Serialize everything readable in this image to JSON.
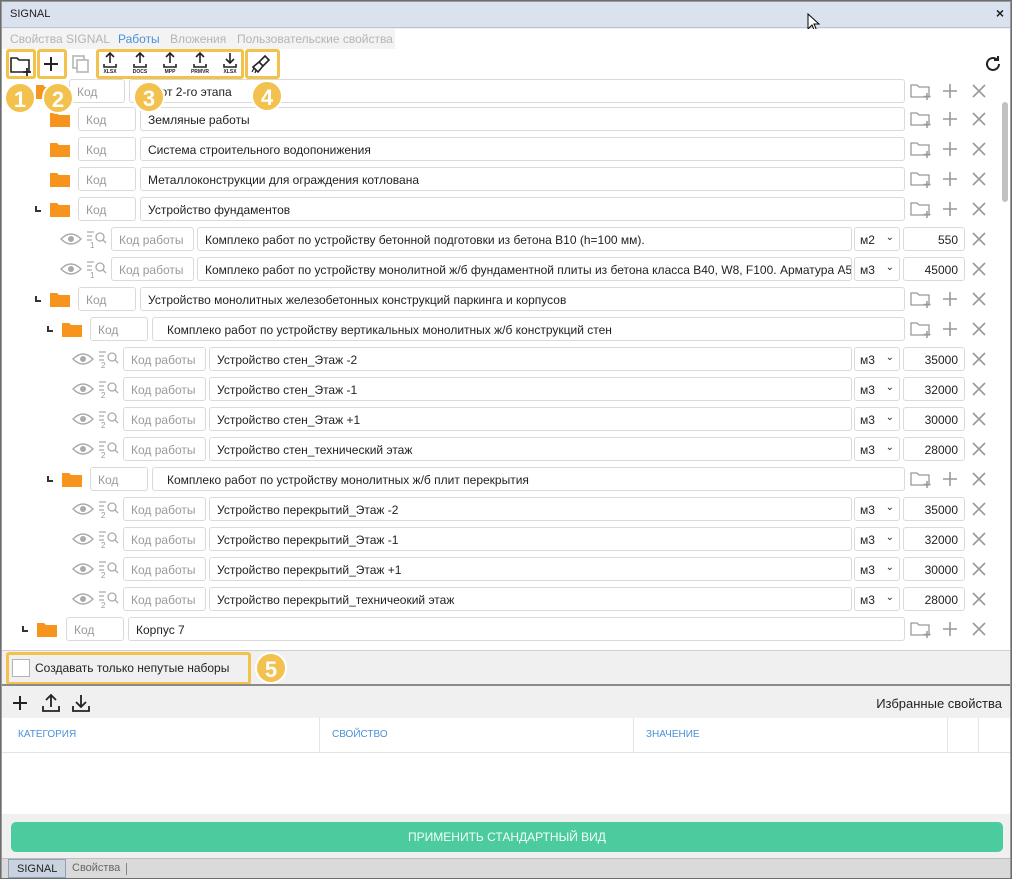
{
  "window": {
    "title": "SIGNAL",
    "close_icon": "×"
  },
  "tabs": [
    {
      "label": "Свойства SIGNAL",
      "active": false
    },
    {
      "label": "Работы",
      "active": true
    },
    {
      "label": "Вложения",
      "active": false
    },
    {
      "label": "Пользовательские свойства",
      "active": false
    }
  ],
  "toolbar": {
    "export_labels": [
      "XLSX",
      "DOCS",
      "MPP",
      "PRMVR",
      "XLSX"
    ],
    "badges": [
      "1",
      "2",
      "3",
      "4",
      "5"
    ],
    "highlight_color": "#f2c14e"
  },
  "tree": {
    "code_placeholder": "Код",
    "work_code_placeholder": "Код работы",
    "rows": [
      {
        "type": "group",
        "name": "...абот 2-го этапа"
      },
      {
        "type": "group",
        "name": "Земляные работы"
      },
      {
        "type": "group",
        "name": "Система строительного водопонижения"
      },
      {
        "type": "group",
        "name": "Металлоконструкции для ограждения котлована"
      },
      {
        "type": "group",
        "name": "Устройство фундаментов"
      },
      {
        "type": "work",
        "count": "1",
        "name": "Комплеко работ по устройству бетонной подготовки из бетона B10 (h=100 мм).",
        "unit": "м2",
        "qty": "550"
      },
      {
        "type": "work",
        "count": "1",
        "name": "Комплеко работ по устройству монолитной ж/б фундаментной плиты из бетона класса B40, W8, F100. Арматура А5",
        "unit": "м3",
        "qty": "45000"
      },
      {
        "type": "group",
        "name": "Устройство монолитных железобетонных конструкций паркинга и корпусов"
      },
      {
        "type": "group",
        "name": "Комплеко работ по устройству вертикальных монолитных ж/б конструкций стен"
      },
      {
        "type": "work",
        "count": "2",
        "name": "Устройство стен_Этаж -2",
        "unit": "м3",
        "qty": "35000"
      },
      {
        "type": "work",
        "count": "2",
        "name": "Устройство стен_Этаж -1",
        "unit": "м3",
        "qty": "32000"
      },
      {
        "type": "work",
        "count": "2",
        "name": "Устройство стен_Этаж +1",
        "unit": "м3",
        "qty": "30000"
      },
      {
        "type": "work",
        "count": "2",
        "name": "Устройство стен_технический этаж",
        "unit": "м3",
        "qty": "28000"
      },
      {
        "type": "group",
        "name": "Комплеко работ по устройству монолитных ж/б плит перекрытия"
      },
      {
        "type": "work",
        "count": "2",
        "name": "Устройство перекрытий_Этаж -2",
        "unit": "м3",
        "qty": "35000"
      },
      {
        "type": "work",
        "count": "2",
        "name": "Устройство перекрытий_Этаж -1",
        "unit": "м3",
        "qty": "32000"
      },
      {
        "type": "work",
        "count": "2",
        "name": "Устройство перекрытий_Этаж +1",
        "unit": "м3",
        "qty": "30000"
      },
      {
        "type": "work",
        "count": "2",
        "name": "Устройство перекрытий_техничеокий этаж",
        "unit": "м3",
        "qty": "28000"
      },
      {
        "type": "group",
        "name": "Корпус 7"
      }
    ]
  },
  "options": {
    "only_nonempty_label": "Создавать только непутые наборы"
  },
  "props": {
    "title": "Избранные свойства",
    "columns": [
      "КАТЕГОРИЯ",
      "СВОЙСТВО",
      "ЗНАЧЕНИЕ"
    ]
  },
  "apply_label": "ПРИМЕНИТЬ СТАНДАРТНЫЙ ВИД",
  "bottom_tabs": [
    "SIGNAL",
    "Свойства"
  ],
  "colors": {
    "accent": "#4a90d9",
    "folder": "#f7941d",
    "apply": "#4ccb9f"
  }
}
